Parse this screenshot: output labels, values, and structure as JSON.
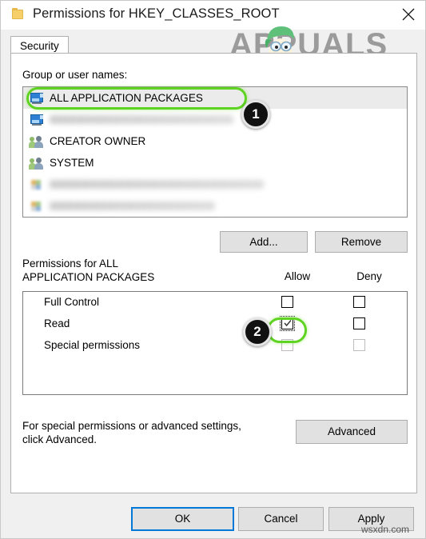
{
  "window": {
    "title": "Permissions for HKEY_CLASSES_ROOT",
    "folder_icon": "folder-icon",
    "close_icon": "close-icon"
  },
  "watermark": {
    "text": "APPUALS",
    "mascot": "appuals-mascot-icon"
  },
  "tabs": [
    {
      "label": "Security",
      "selected": true
    }
  ],
  "group_section": {
    "label": "Group or user names:",
    "rows": [
      {
        "label": "ALL APPLICATION PACKAGES",
        "icon": "package-icon",
        "selected": true,
        "blurred": false
      },
      {
        "label": "",
        "icon": "package-icon",
        "selected": false,
        "blurred": true,
        "blur_width": 230
      },
      {
        "label": "CREATOR OWNER",
        "icon": "users-icon",
        "selected": false,
        "blurred": false
      },
      {
        "label": "SYSTEM",
        "icon": "users-icon",
        "selected": false,
        "blurred": false
      },
      {
        "label": "",
        "icon": "small-icon",
        "selected": false,
        "blurred": true,
        "blur_width": 268
      },
      {
        "label": "",
        "icon": "small-icon",
        "selected": false,
        "blurred": true,
        "blur_width": 207
      }
    ],
    "buttons": {
      "add": "Add...",
      "remove": "Remove"
    }
  },
  "permissions_section": {
    "label": "Permissions for ALL\nAPPLICATION PACKAGES",
    "label_line1": "Permissions for ALL",
    "label_line2": "APPLICATION PACKAGES",
    "column_allow": "Allow",
    "column_deny": "Deny",
    "rows": [
      {
        "name": "Full Control",
        "allow": false,
        "deny": false,
        "disabled": false,
        "focused": false
      },
      {
        "name": "Read",
        "allow": true,
        "deny": false,
        "disabled": false,
        "focused": true
      },
      {
        "name": "Special permissions",
        "allow": false,
        "deny": false,
        "disabled": true,
        "focused": false
      }
    ]
  },
  "footer": {
    "note_line1": "For special permissions or advanced settings,",
    "note_line2": "click Advanced.",
    "advanced_button": "Advanced"
  },
  "dialog_buttons": {
    "ok": "OK",
    "cancel": "Cancel",
    "apply": "Apply"
  },
  "annotations": {
    "badge_1": "1",
    "badge_2": "2",
    "highlight_color": "#5fd322",
    "badge_color": "#111111"
  },
  "site_stamp": "wsxdn.com"
}
